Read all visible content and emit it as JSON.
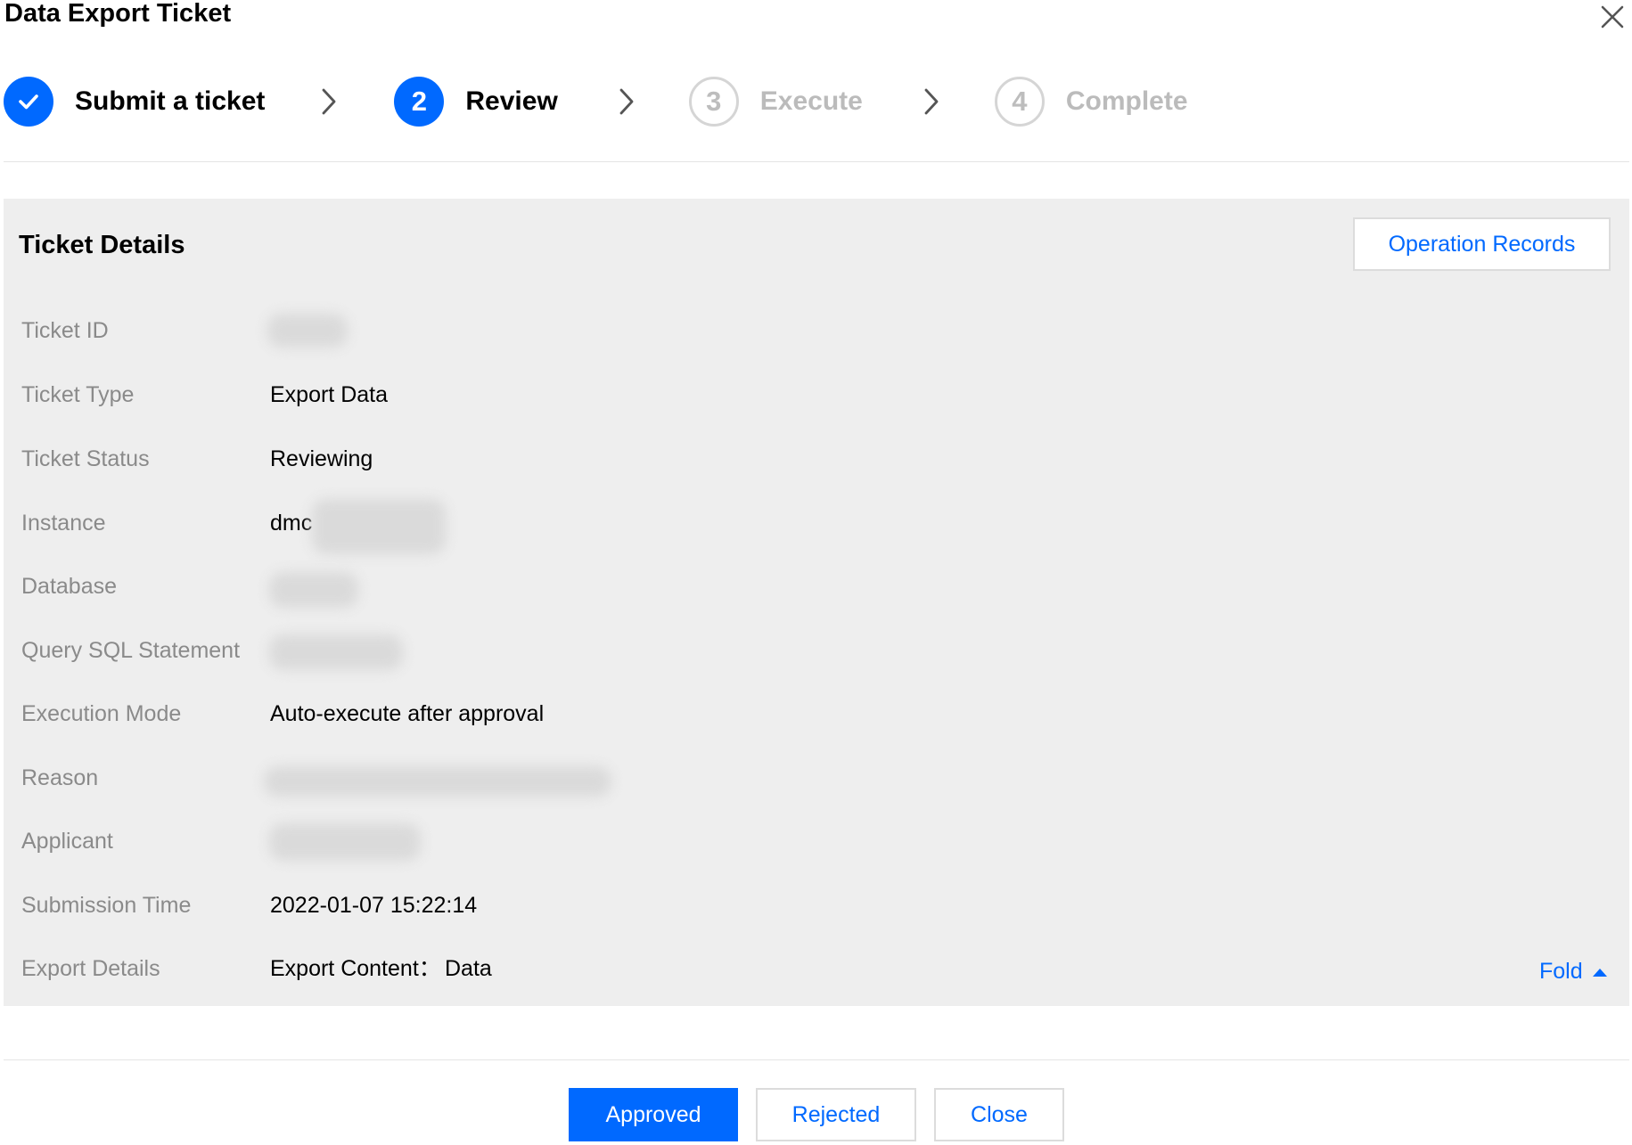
{
  "dialog": {
    "title": "Data Export Ticket",
    "close_icon": "close-icon"
  },
  "steps": [
    {
      "number": "",
      "label": "Submit a ticket",
      "state": "done",
      "icon": "check-icon"
    },
    {
      "number": "2",
      "label": "Review",
      "state": "active"
    },
    {
      "number": "3",
      "label": "Execute",
      "state": "pending"
    },
    {
      "number": "4",
      "label": "Complete",
      "state": "pending"
    }
  ],
  "details": {
    "title": "Ticket Details",
    "operation_records_label": "Operation Records",
    "fields": {
      "ticket_id": {
        "label": "Ticket ID"
      },
      "ticket_type": {
        "label": "Ticket Type",
        "value": "Export Data"
      },
      "ticket_status": {
        "label": "Ticket Status",
        "value": "Reviewing"
      },
      "instance": {
        "label": "Instance",
        "value": "dmc"
      },
      "database": {
        "label": "Database"
      },
      "query_sql": {
        "label": "Query SQL Statement"
      },
      "execution_mode": {
        "label": "Execution Mode",
        "value": "Auto-execute after approval"
      },
      "reason": {
        "label": "Reason"
      },
      "applicant": {
        "label": "Applicant"
      },
      "submission_time": {
        "label": "Submission Time",
        "value": "2022-01-07 15:22:14"
      },
      "export_details": {
        "label": "Export Details",
        "content_label": "Export Content：",
        "content_value": "Data"
      }
    },
    "fold_label": "Fold"
  },
  "footer": {
    "approved_label": "Approved",
    "rejected_label": "Rejected",
    "close_label": "Close"
  },
  "colors": {
    "accent": "#0069ff",
    "panel_bg": "#eeeeee",
    "label_gray": "#8a8a8a",
    "pending_gray": "#bbbbbb"
  }
}
